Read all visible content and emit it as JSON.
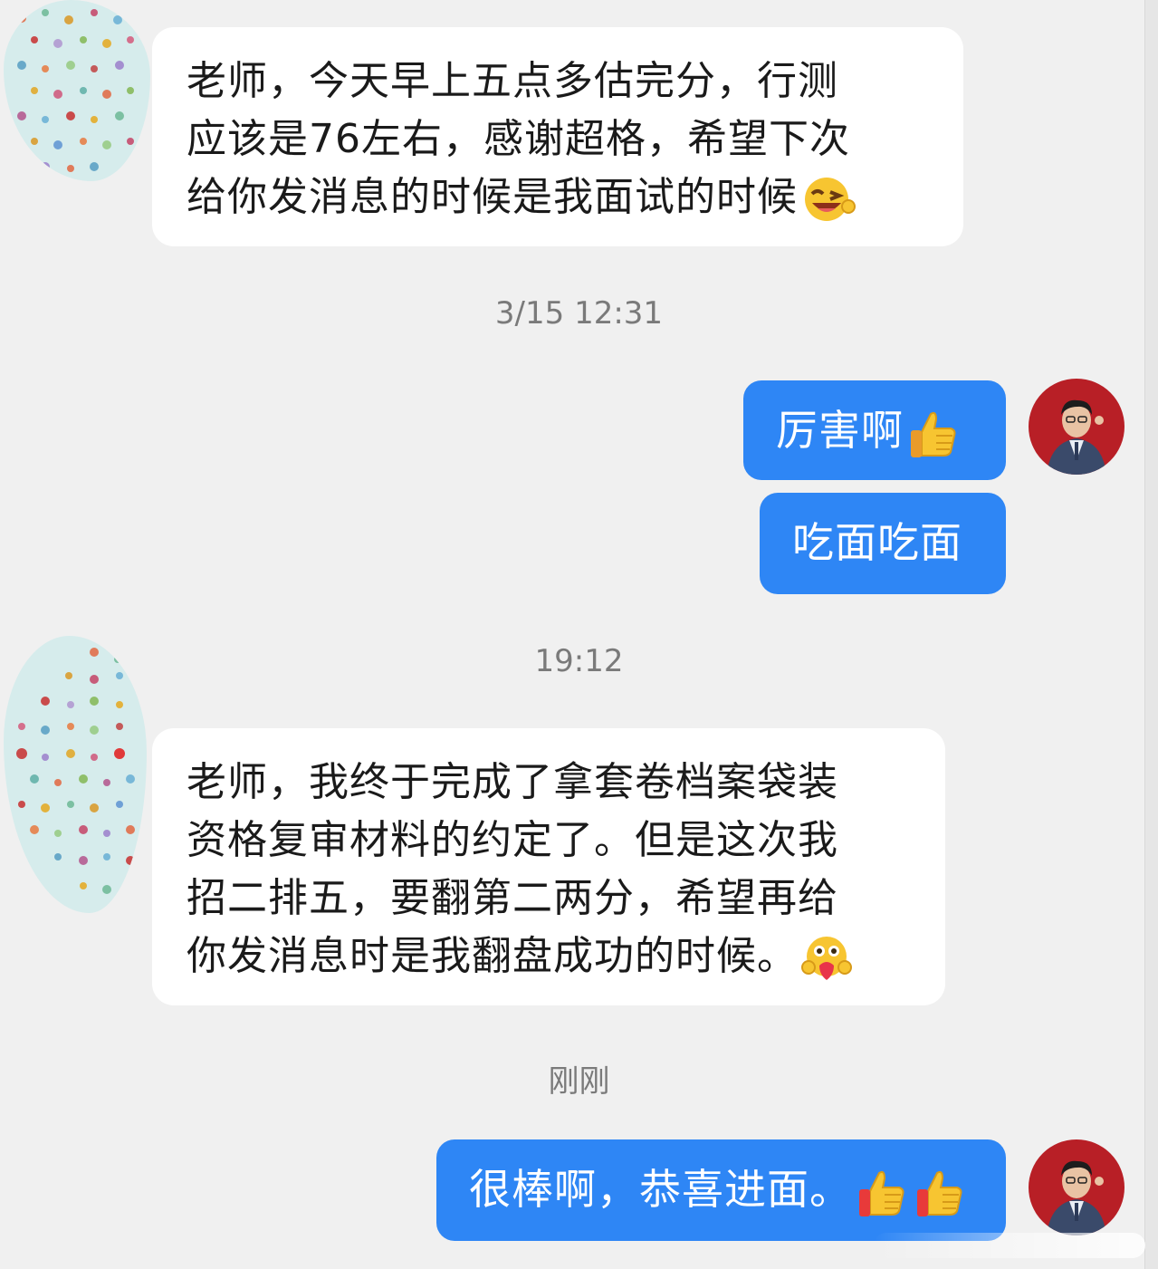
{
  "conversation": {
    "messages": [
      {
        "side": "incoming",
        "lines": [
          "老师，今天早上五点多估完分，行测",
          "应该是76左右，感谢超格，希望下次",
          "给你发消息的时候是我面试的时候"
        ],
        "emoji": "grinning-wink-emoji"
      },
      {
        "kind": "timestamp",
        "text": "3/15 12:31"
      },
      {
        "side": "outgoing",
        "text": "厉害啊",
        "emoji": "thumbs-up-emoji"
      },
      {
        "side": "outgoing",
        "text": "吃面吃面"
      },
      {
        "kind": "timestamp",
        "text": "19:12"
      },
      {
        "side": "incoming",
        "lines": [
          "老师，我终于完成了拿套卷档案袋装",
          "资格复审材料的约定了。但是这次我",
          "招二排五，要翻第二两分，希望再给",
          "你发消息时是我翻盘成功的时候。"
        ],
        "emoji": "hugging-heart-emoji"
      },
      {
        "kind": "timestamp",
        "text": "刚刚"
      },
      {
        "side": "outgoing",
        "text": "很棒啊，恭喜进面。",
        "emoji": "two-thumbs-up-emoji"
      }
    ]
  },
  "colors": {
    "background": "#f0f0f0",
    "incoming_bubble": "#ffffff",
    "outgoing_bubble": "#2e86f5",
    "timestamp": "#7a7a7a"
  }
}
